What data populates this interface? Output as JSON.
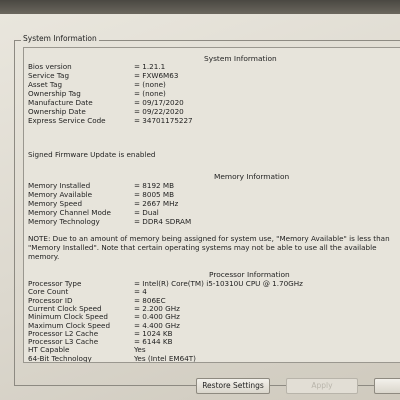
{
  "group_title": "System Information",
  "system": {
    "title": "System Information",
    "rows": [
      {
        "label": "Bios version",
        "value": "= 1.21.1"
      },
      {
        "label": "Service Tag",
        "value": "= FXW6M63"
      },
      {
        "label": "Asset Tag",
        "value": "= (none)"
      },
      {
        "label": "Ownership Tag",
        "value": "= (none)"
      },
      {
        "label": "Manufacture Date",
        "value": "= 09/17/2020"
      },
      {
        "label": "Ownership Date",
        "value": "= 09/22/2020"
      },
      {
        "label": "Express Service Code",
        "value": "= 34701175227"
      }
    ],
    "firmware_text": "Signed Firmware Update is enabled"
  },
  "memory": {
    "title": "Memory Information",
    "rows": [
      {
        "label": "Memory Installed",
        "value": "= 8192 MB"
      },
      {
        "label": "Memory Available",
        "value": "= 8005 MB"
      },
      {
        "label": "Memory Speed",
        "value": "= 2667 MHz"
      },
      {
        "label": "Memory Channel Mode",
        "value": "= Dual"
      },
      {
        "label": "Memory Technology",
        "value": "= DDR4 SDRAM"
      }
    ],
    "note": "NOTE: Due to an amount of memory being assigned for system use, \"Memory Available\" is less than \"Memory Installed\". Note that certain operating systems may not be able to use all the available memory."
  },
  "processor": {
    "title": "Processor Information",
    "rows": [
      {
        "label": "Processor Type",
        "value": "= Intel(R) Core(TM) i5-10310U CPU @ 1.70GHz"
      },
      {
        "label": "Core Count",
        "value": "= 4"
      },
      {
        "label": "Processor ID",
        "value": "= 806EC"
      },
      {
        "label": "Current Clock Speed",
        "value": "= 2.200 GHz"
      },
      {
        "label": "Minimum Clock Speed",
        "value": "= 0.400 GHz"
      },
      {
        "label": "Maximum Clock Speed",
        "value": "= 4.400 GHz"
      },
      {
        "label": "Processor L2 Cache",
        "value": "= 1024 KB"
      },
      {
        "label": "Processor L3 Cache",
        "value": "= 6144 KB"
      },
      {
        "label": "HT Capable",
        "value": "Yes"
      },
      {
        "label": "64-Bit Technology",
        "value": "Yes (Intel EM64T)"
      }
    ]
  },
  "buttons": {
    "restore": "Restore Settings",
    "apply": "Apply"
  }
}
